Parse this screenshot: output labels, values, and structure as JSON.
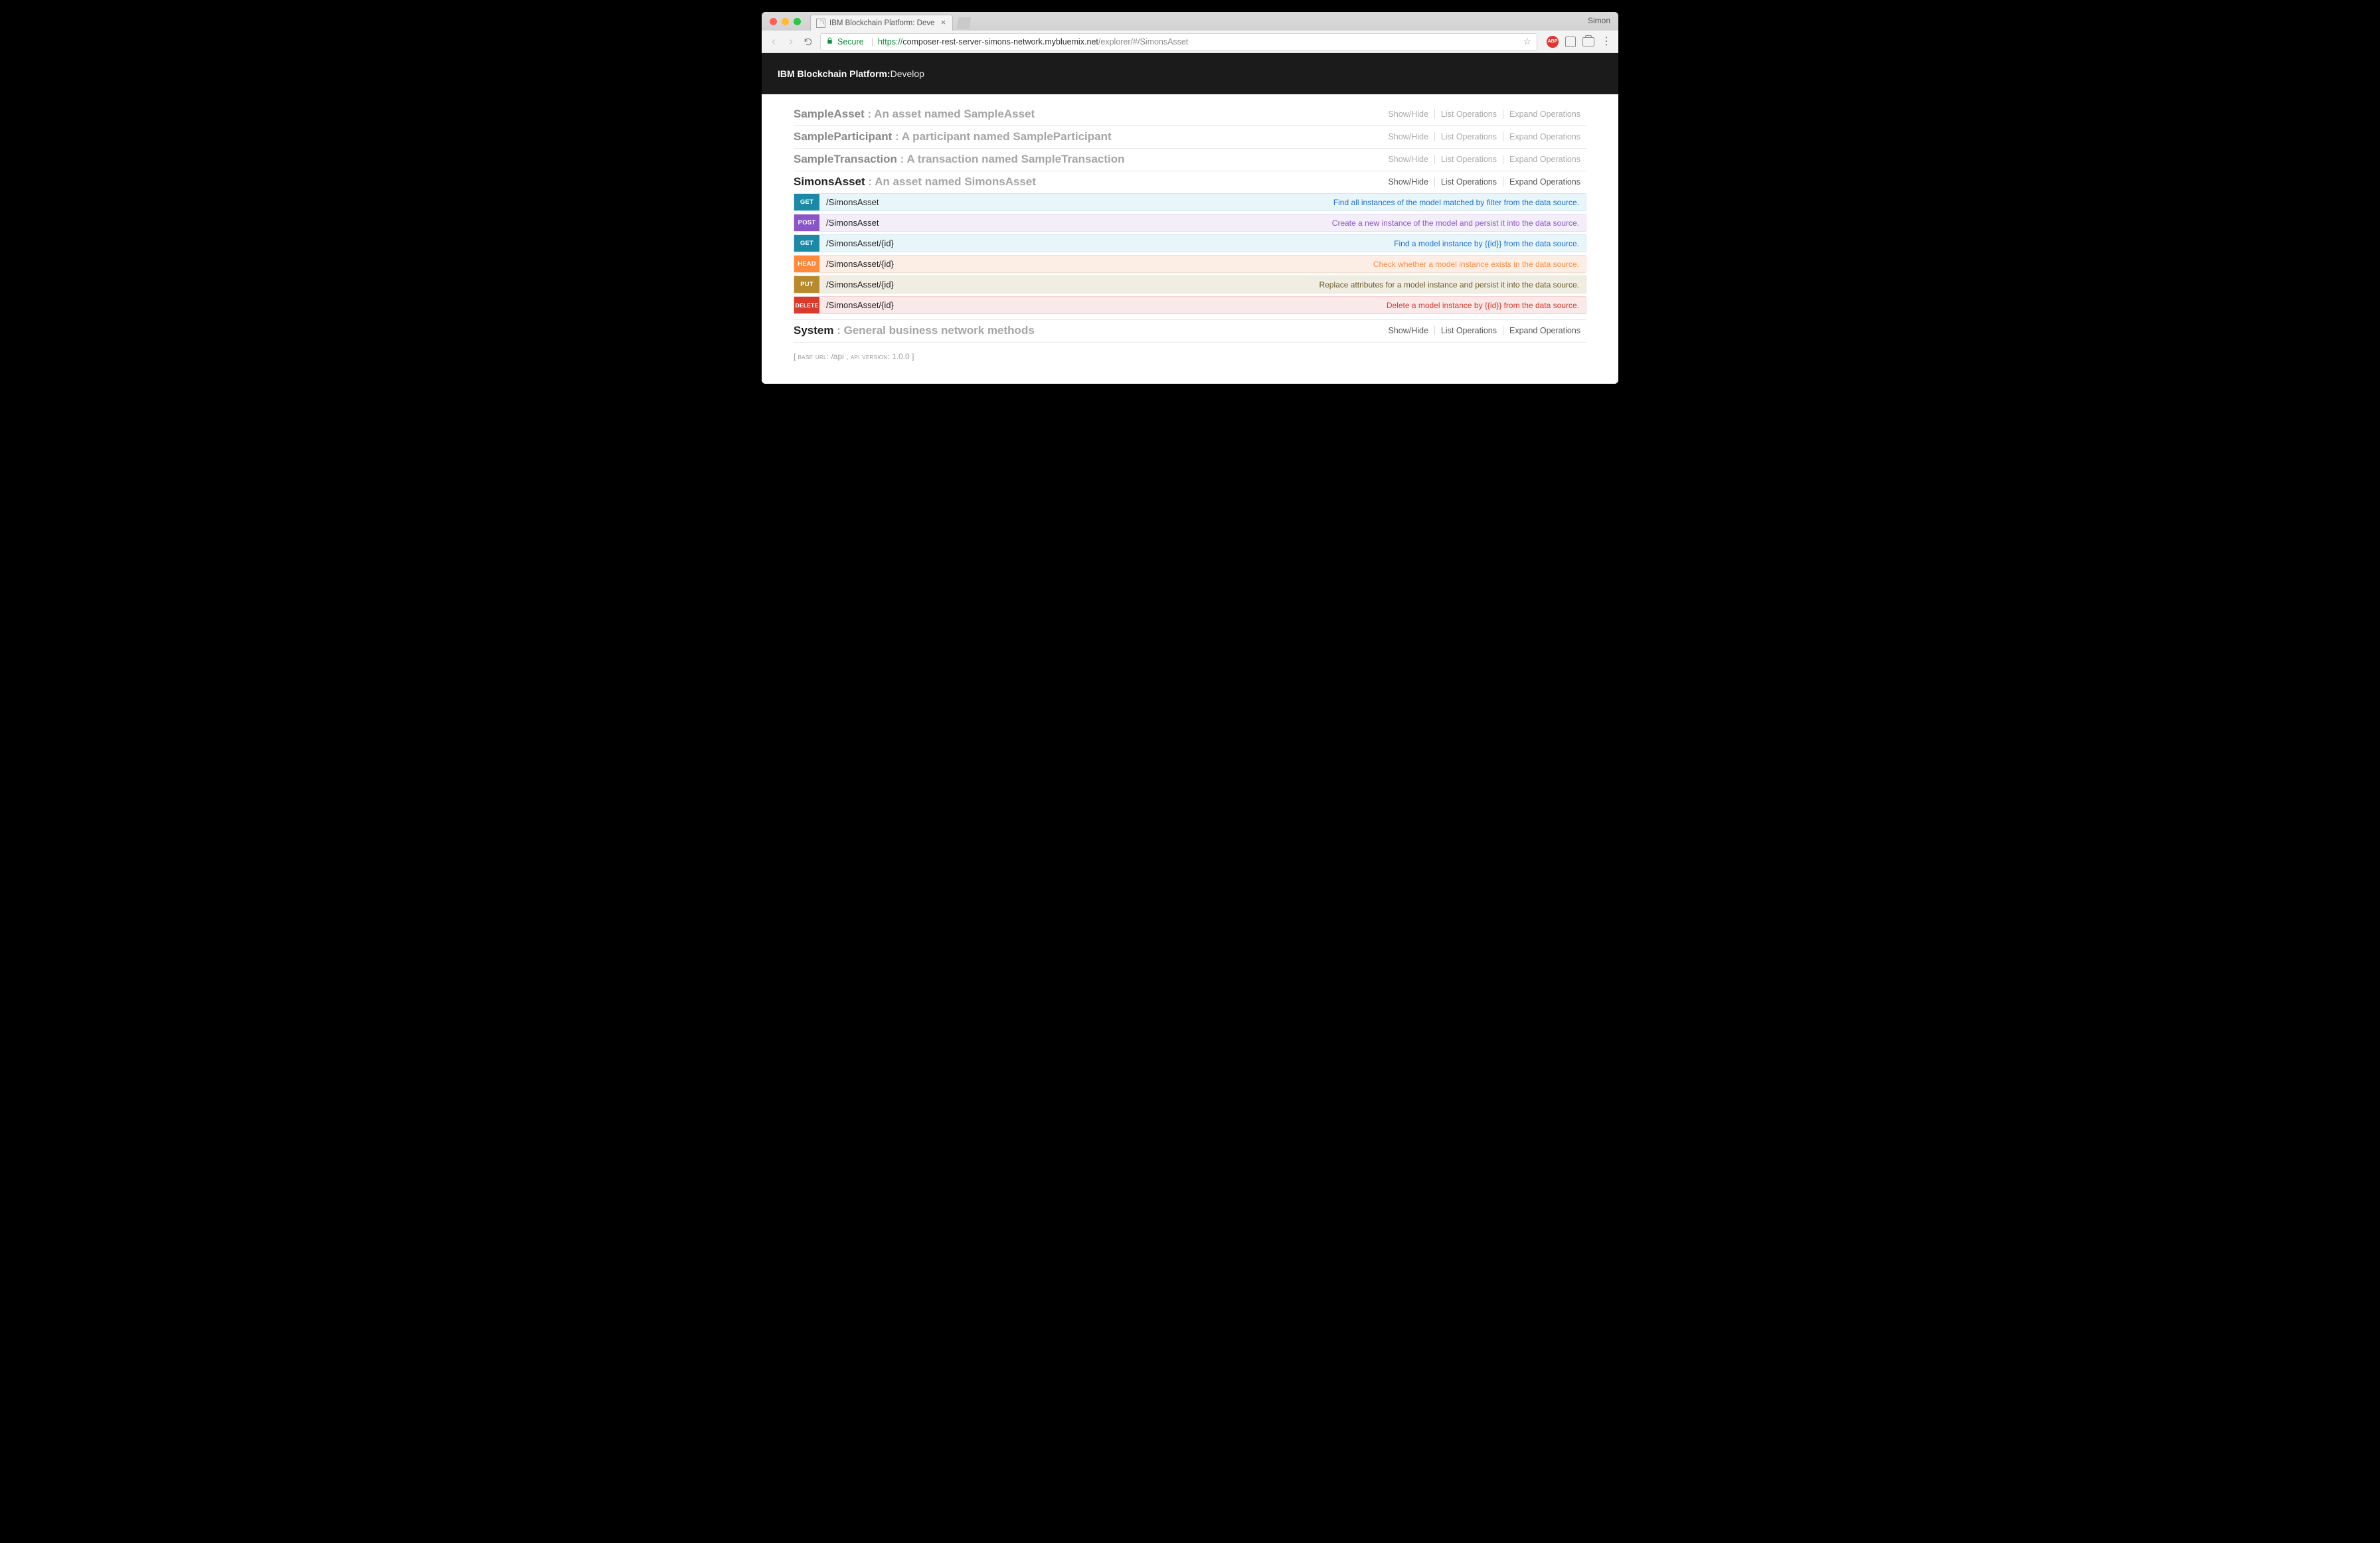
{
  "browser": {
    "tab_title": "IBM Blockchain Platform: Deve",
    "profile": "Simon",
    "secure_label": "Secure",
    "url_proto": "https://",
    "url_host": "composer-rest-server-simons-network.mybluemix.net",
    "url_path": "/explorer/#/SimonsAsset"
  },
  "header": {
    "brand_bold": "IBM Blockchain Platform:",
    "brand_light": " Develop"
  },
  "actions": {
    "show_hide": "Show/Hide",
    "list_ops": "List Operations",
    "expand_ops": "Expand Operations"
  },
  "sections": [
    {
      "name": "SampleAsset",
      "desc": "An asset named SampleAsset",
      "active": false,
      "ops": []
    },
    {
      "name": "SampleParticipant",
      "desc": "A participant named SampleParticipant",
      "active": false,
      "ops": []
    },
    {
      "name": "SampleTransaction",
      "desc": "A transaction named SampleTransaction",
      "active": false,
      "ops": []
    },
    {
      "name": "SimonsAsset",
      "desc": "An asset named SimonsAsset",
      "active": true,
      "ops": [
        {
          "method": "GET",
          "path": "/SimonsAsset",
          "desc": "Find all instances of the model matched by filter from the data source."
        },
        {
          "method": "POST",
          "path": "/SimonsAsset",
          "desc": "Create a new instance of the model and persist it into the data source."
        },
        {
          "method": "GET",
          "path": "/SimonsAsset/{id}",
          "desc": "Find a model instance by {{id}} from the data source."
        },
        {
          "method": "HEAD",
          "path": "/SimonsAsset/{id}",
          "desc": "Check whether a model instance exists in the data source."
        },
        {
          "method": "PUT",
          "path": "/SimonsAsset/{id}",
          "desc": "Replace attributes for a model instance and persist it into the data source."
        },
        {
          "method": "DELETE",
          "path": "/SimonsAsset/{id}",
          "desc": "Delete a model instance by {{id}} from the data source."
        }
      ]
    },
    {
      "name": "System",
      "desc": "General business network methods",
      "active": true,
      "ops": []
    }
  ],
  "footer": {
    "base_label": "base url",
    "base_value": "/api",
    "version_label": "api version",
    "version_value": "1.0.0"
  }
}
